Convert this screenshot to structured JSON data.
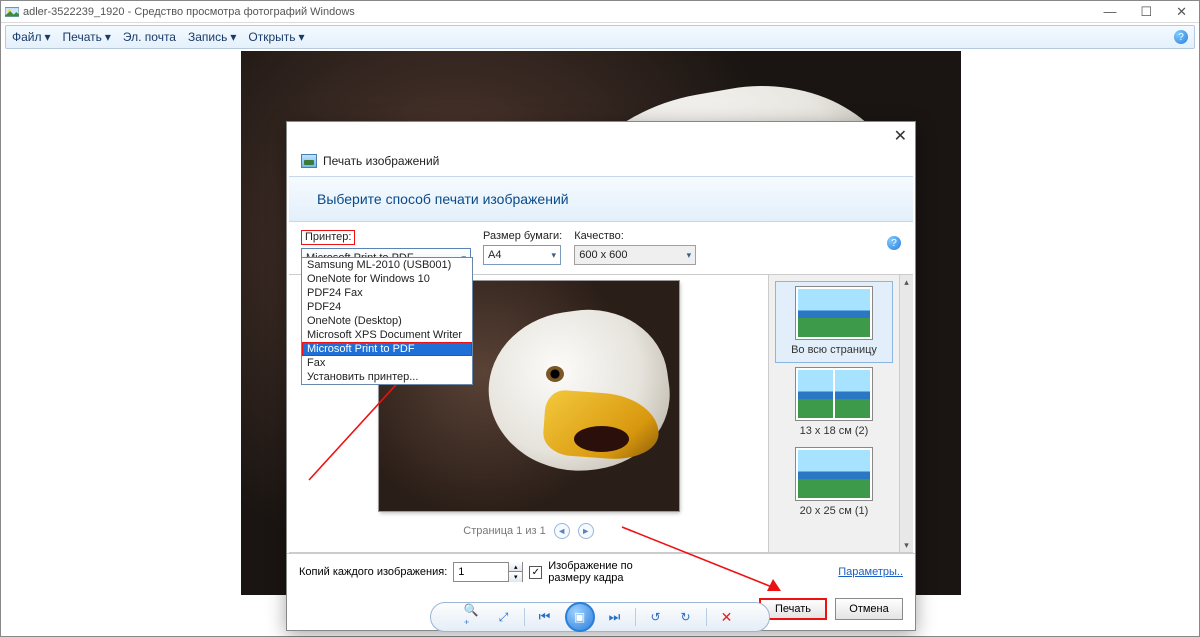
{
  "titlebar": {
    "filename": "adler-3522239_1920",
    "app_name": "Средство просмотра фотографий Windows"
  },
  "menubar": {
    "file": "Файл",
    "print": "Печать",
    "email": "Эл. почта",
    "burn": "Запись",
    "open": "Открыть"
  },
  "dialog": {
    "title": "Печать изображений",
    "banner": "Выберите способ печати изображений",
    "printer_label": "Принтер:",
    "paper_label": "Размер бумаги:",
    "quality_label": "Качество:",
    "printer_value": "Microsoft Print to PDF",
    "paper_value": "A4",
    "quality_value": "600 x 600",
    "printer_options": [
      "Samsung ML-2010 (USB001)",
      "OneNote for Windows 10",
      "PDF24 Fax",
      "PDF24",
      "OneNote (Desktop)",
      "Microsoft XPS Document Writer",
      "Microsoft Print to PDF",
      "Fax",
      "Установить принтер..."
    ],
    "page_counter": "Страница 1 из 1",
    "layouts": [
      {
        "label": "Во всю страницу",
        "cells": 1,
        "selected": true
      },
      {
        "label": "13 x 18 см (2)",
        "cells": 2,
        "selected": false
      },
      {
        "label": "20 x 25 см (1)",
        "cells": 1,
        "selected": false
      }
    ],
    "copies_label": "Копий каждого изображения:",
    "copies_value": "1",
    "fit_label": "Изображение по размеру кадра",
    "fit_checked": true,
    "options_link": "Параметры..",
    "print_btn": "Печать",
    "cancel_btn": "Отмена"
  }
}
